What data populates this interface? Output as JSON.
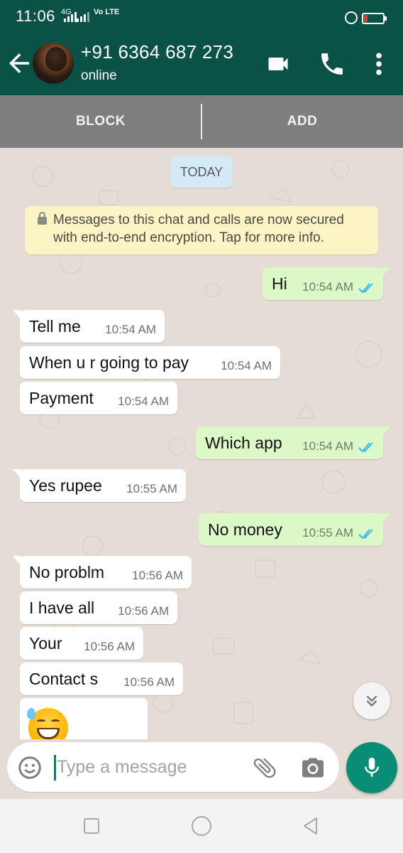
{
  "status_bar": {
    "time": "11:06",
    "network": "4G",
    "volte": "Vo LTE",
    "battery_color": "#e53935"
  },
  "header": {
    "contact_name": "+91 6364 687 273",
    "contact_status": "online",
    "icons": [
      "back-arrow-icon",
      "video-call-icon",
      "phone-icon",
      "more-vert-icon"
    ],
    "bg_color": "#0a5245"
  },
  "actions": {
    "block_label": "BLOCK",
    "add_label": "ADD"
  },
  "chat": {
    "date_label": "TODAY",
    "encryption_notice": "Messages to this chat and calls are now secured with end-to-end encryption. Tap for more info.",
    "messages": [
      {
        "direction": "out",
        "text": "Hi",
        "time": "10:54 AM",
        "read": true
      },
      {
        "direction": "in",
        "text": "Tell me",
        "time": "10:54 AM"
      },
      {
        "direction": "in",
        "text": "When u r going to pay",
        "time": "10:54 AM"
      },
      {
        "direction": "in",
        "text": "Payment",
        "time": "10:54 AM"
      },
      {
        "direction": "out",
        "text": "Which app",
        "time": "10:54 AM",
        "read": true
      },
      {
        "direction": "in",
        "text": "Yes rupee",
        "time": "10:55 AM"
      },
      {
        "direction": "out",
        "text": "No money",
        "time": "10:55 AM",
        "read": true
      },
      {
        "direction": "in",
        "text": "No problm",
        "time": "10:56 AM"
      },
      {
        "direction": "in",
        "text": "I have all",
        "time": "10:56 AM"
      },
      {
        "direction": "in",
        "text": "Your",
        "time": "10:56 AM"
      },
      {
        "direction": "in",
        "text": "Contact s",
        "time": "10:56 AM"
      }
    ],
    "last_message_emoji": "grinning-face-with-sweat-emoji",
    "colors": {
      "incoming": "#ffffff",
      "outgoing": "#dcf8c6",
      "read_ticks": "#34b7f1"
    }
  },
  "composer": {
    "placeholder": "Type a message",
    "value": "",
    "icons": [
      "emoji-icon",
      "attach-icon",
      "camera-icon",
      "mic-icon"
    ],
    "mic_color": "#0a8d76"
  },
  "navbar": {
    "icons": [
      "recent-apps-icon",
      "home-icon",
      "back-icon"
    ]
  }
}
